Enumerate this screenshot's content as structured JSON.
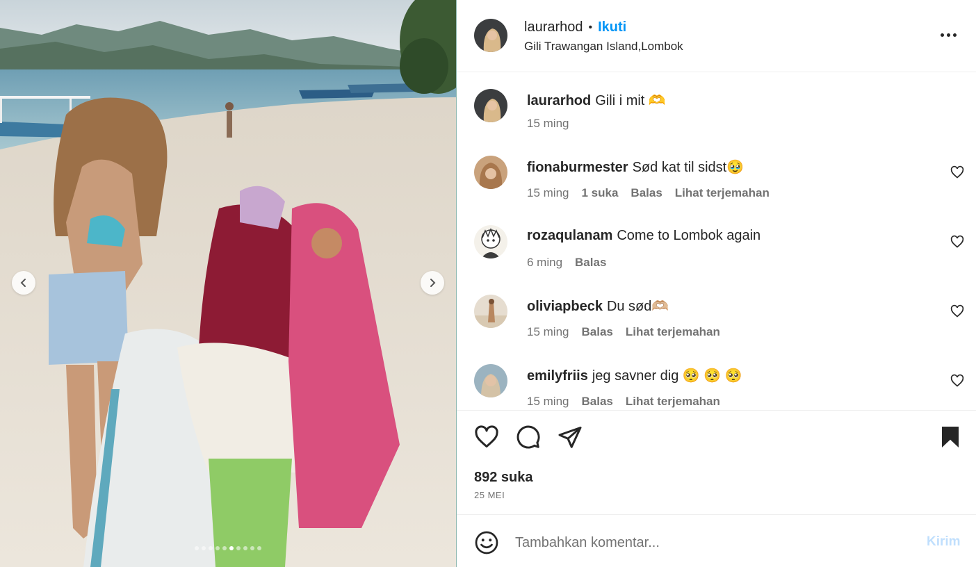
{
  "post": {
    "username": "laurarhod",
    "separator": "•",
    "follow_label": "Ikuti",
    "location": "Gili Trawangan Island,Lombok",
    "more_icon": "more-horizontal-icon"
  },
  "caption": {
    "username": "laurarhod",
    "text": "Gili i mit 🫶",
    "time": "15 ming"
  },
  "comments": [
    {
      "username": "fionaburmester",
      "text": "Sød kat til sidst🥹",
      "time": "15 ming",
      "likes": "1 suka",
      "reply": "Balas",
      "translate": "Lihat terjemahan"
    },
    {
      "username": "rozaqulanam",
      "text": "Come to Lombok again",
      "time": "6 ming",
      "reply": "Balas"
    },
    {
      "username": "oliviapbeck",
      "text": "Du sød🫶🏼",
      "time": "15 ming",
      "reply": "Balas",
      "translate": "Lihat terjemahan"
    },
    {
      "username": "emilyfriis",
      "text": "jeg savner dig 🥺 🥺 🥺",
      "time": "15 ming",
      "reply": "Balas",
      "translate": "Lihat terjemahan"
    }
  ],
  "actions": {
    "likes_count": "892 suka",
    "date": "25 MEI"
  },
  "composer": {
    "placeholder": "Tambahkan komentar...",
    "post_label": "Kirim"
  },
  "carousel": {
    "total_slides": 10,
    "active_slide": 6
  },
  "colors": {
    "link_blue": "#0095f6",
    "post_disabled": "#c0dffd",
    "text_primary": "#262626",
    "text_secondary": "#737373"
  }
}
